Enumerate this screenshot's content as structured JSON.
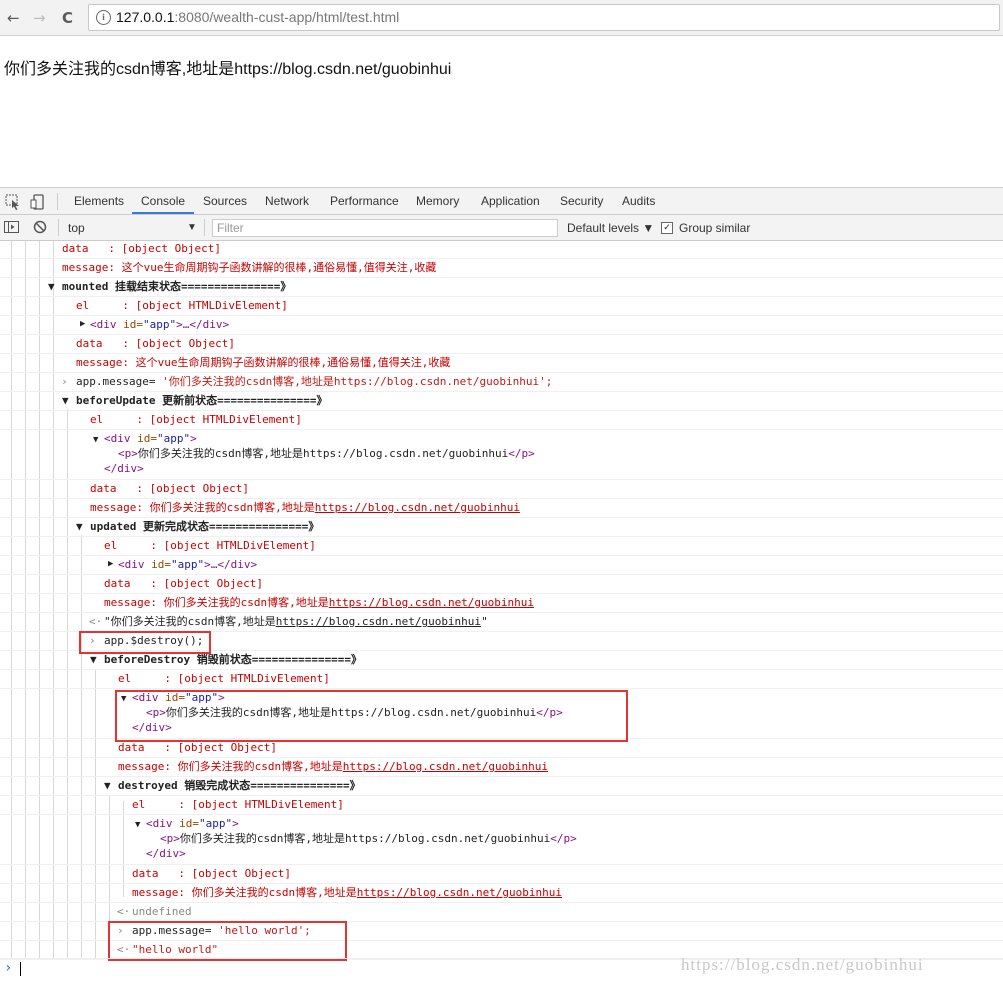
{
  "browser": {
    "back": "←",
    "forward": "→",
    "reload": "C",
    "url_host": "127.0.0.1",
    "url_path": ":8080/wealth-cust-app/html/test.html"
  },
  "page": {
    "text": "你们多关注我的csdn博客,地址是https://blog.csdn.net/guobinhui"
  },
  "devtools": {
    "tabs": [
      "Elements",
      "Console",
      "Sources",
      "Network",
      "Performance",
      "Memory",
      "Application",
      "Security",
      "Audits"
    ],
    "active_tab": "Console",
    "context": "top",
    "filter_placeholder": "Filter",
    "levels": "Default levels ▼",
    "group_similar": "Group similar"
  },
  "console": {
    "data_row": "data   : [object Object]",
    "message_row": "message: 这个vue生命周期钩子函数讲解的很棒,通俗易懂,值得关注,收藏",
    "mounted_head": "mounted",
    "mounted_title": " 挂载结束状态===============》",
    "el_row": "el     : [object HTMLDivElement]",
    "div_collapsed_open": "<div",
    "div_id_attr": " id=",
    "div_id_val": "\"app\"",
    "div_collapsed_close": ">…</div>",
    "cmd1_prefix": "app.message= ",
    "cmd1_str": "'你们多关注我的csdn博客,地址是https://blog.csdn.net/guobinhui';",
    "before_update_head": "beforeUpdate",
    "before_update_title": " 更新前状态===============》",
    "p_open": "<p>",
    "p_text": "你们多关注我的csdn博客,地址是https://blog.csdn.net/guobinhui",
    "p_close": "</p>",
    "div_close": "</div>",
    "message_prefix": "message: ",
    "msg_text_a": "你们多关注我的csdn博客,地址是",
    "msg_link": "https://blog.csdn.net/guobinhui",
    "updated_head": "updated",
    "updated_title": " 更新完成状态===============》",
    "return1_a": "\"你们多关注我的csdn博客,地址是",
    "return1_link": "https://blog.csdn.net/guobinhui",
    "return1_b": "\"",
    "cmd2": "app.$destroy();",
    "before_destroy_head": "beforeDestroy",
    "before_destroy_title": " 销毁前状态===============》",
    "destroyed_head": "destroyed",
    "destroyed_title": " 销毁完成状态===============》",
    "undefined": "undefined",
    "cmd3_prefix": "app.message= ",
    "cmd3_str": "'hello world';",
    "return3": "\"hello world\""
  },
  "watermark": "https://blog.csdn.net/guobinhui"
}
